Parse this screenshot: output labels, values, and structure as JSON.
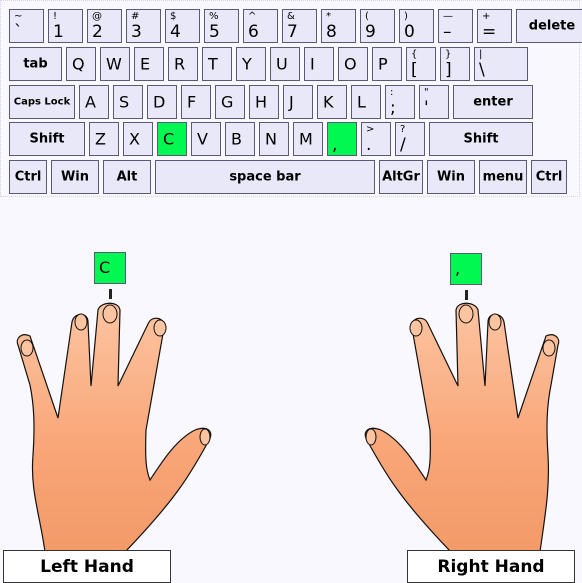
{
  "keyboard": {
    "row1": [
      {
        "upper": "~",
        "lower": "`"
      },
      {
        "upper": "!",
        "lower": "1"
      },
      {
        "upper": "@",
        "lower": "2"
      },
      {
        "upper": "#",
        "lower": "3"
      },
      {
        "upper": "$",
        "lower": "4"
      },
      {
        "upper": "%",
        "lower": "5"
      },
      {
        "upper": "^",
        "lower": "6"
      },
      {
        "upper": "&",
        "lower": "7"
      },
      {
        "upper": "*",
        "lower": "8"
      },
      {
        "upper": "(",
        "lower": "9"
      },
      {
        "upper": ")",
        "lower": "0"
      },
      {
        "upper": "—",
        "lower": "–"
      },
      {
        "upper": "+",
        "lower": "="
      },
      {
        "label": "delete"
      }
    ],
    "row2": [
      {
        "label": "tab"
      },
      {
        "main": "Q"
      },
      {
        "main": "W"
      },
      {
        "main": "E"
      },
      {
        "main": "R"
      },
      {
        "main": "T"
      },
      {
        "main": "Y"
      },
      {
        "main": "U"
      },
      {
        "main": "I"
      },
      {
        "main": "O"
      },
      {
        "main": "P"
      },
      {
        "upper": "{",
        "lower": "["
      },
      {
        "upper": "}",
        "lower": "]"
      },
      {
        "upper": "|",
        "lower": "\\"
      }
    ],
    "row3": [
      {
        "label": "Caps Lock"
      },
      {
        "main": "A"
      },
      {
        "main": "S"
      },
      {
        "main": "D"
      },
      {
        "main": "F"
      },
      {
        "main": "G"
      },
      {
        "main": "H"
      },
      {
        "main": "J"
      },
      {
        "main": "K"
      },
      {
        "main": "L"
      },
      {
        "upper": ":",
        "lower": ";"
      },
      {
        "upper": "\"",
        "lower": "'"
      },
      {
        "label": "enter"
      }
    ],
    "row4": [
      {
        "label": "Shift"
      },
      {
        "main": "Z"
      },
      {
        "main": "X"
      },
      {
        "main": "C",
        "highlight": true
      },
      {
        "main": "V"
      },
      {
        "main": "B"
      },
      {
        "main": "N"
      },
      {
        "main": "M"
      },
      {
        "upper": "",
        "lower": ",",
        "highlight": true
      },
      {
        "upper": ">",
        "lower": "."
      },
      {
        "upper": "?",
        "lower": "/"
      },
      {
        "label": "Shift"
      }
    ],
    "row5": [
      {
        "label": "Ctrl"
      },
      {
        "label": "Win"
      },
      {
        "label": "Alt"
      },
      {
        "label": "space bar"
      },
      {
        "label": "AltGr"
      },
      {
        "label": "Win"
      },
      {
        "label": "menu"
      },
      {
        "label": "Ctrl"
      }
    ]
  },
  "highlight_color": "#00f850",
  "left_hand": {
    "label": "Left Hand",
    "active_finger": "middle",
    "key": "C"
  },
  "right_hand": {
    "label": "Right Hand",
    "active_finger": "middle",
    "key": ","
  }
}
